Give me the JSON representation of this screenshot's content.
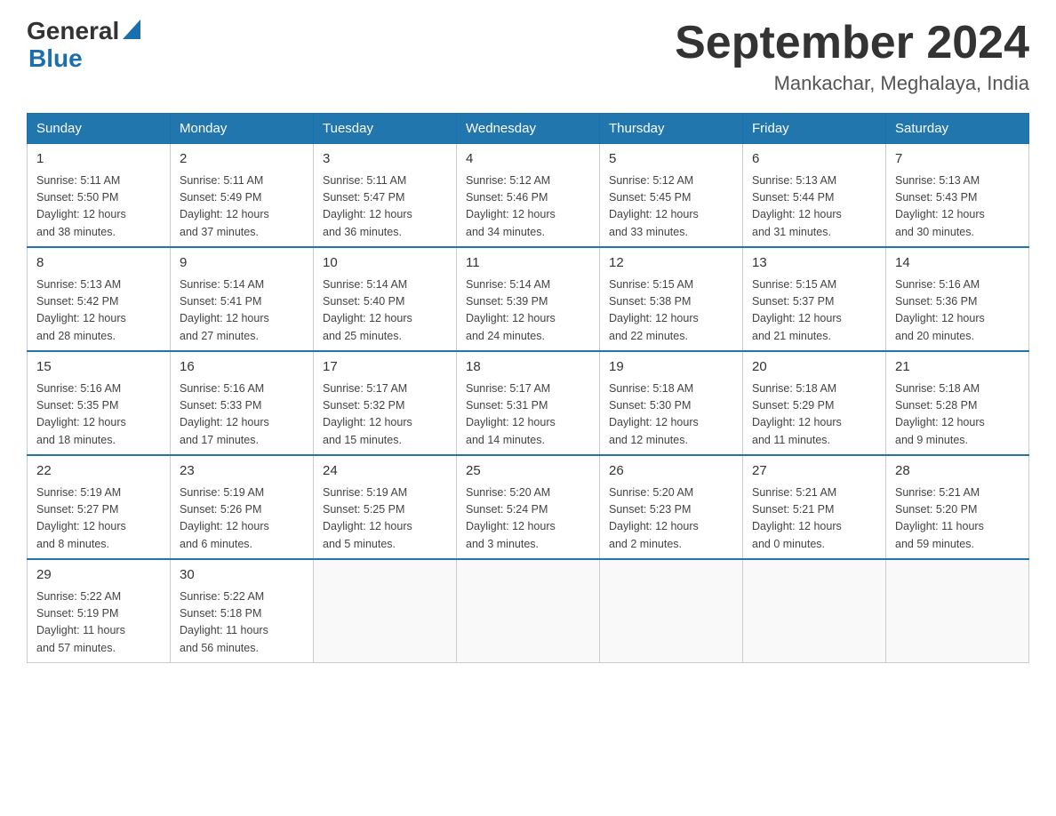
{
  "header": {
    "logo_general": "General",
    "logo_blue": "Blue",
    "month_title": "September 2024",
    "location": "Mankachar, Meghalaya, India"
  },
  "weekdays": [
    "Sunday",
    "Monday",
    "Tuesday",
    "Wednesday",
    "Thursday",
    "Friday",
    "Saturday"
  ],
  "weeks": [
    [
      {
        "day": "1",
        "sunrise": "5:11 AM",
        "sunset": "5:50 PM",
        "daylight": "12 hours and 38 minutes."
      },
      {
        "day": "2",
        "sunrise": "5:11 AM",
        "sunset": "5:49 PM",
        "daylight": "12 hours and 37 minutes."
      },
      {
        "day": "3",
        "sunrise": "5:11 AM",
        "sunset": "5:47 PM",
        "daylight": "12 hours and 36 minutes."
      },
      {
        "day": "4",
        "sunrise": "5:12 AM",
        "sunset": "5:46 PM",
        "daylight": "12 hours and 34 minutes."
      },
      {
        "day": "5",
        "sunrise": "5:12 AM",
        "sunset": "5:45 PM",
        "daylight": "12 hours and 33 minutes."
      },
      {
        "day": "6",
        "sunrise": "5:13 AM",
        "sunset": "5:44 PM",
        "daylight": "12 hours and 31 minutes."
      },
      {
        "day": "7",
        "sunrise": "5:13 AM",
        "sunset": "5:43 PM",
        "daylight": "12 hours and 30 minutes."
      }
    ],
    [
      {
        "day": "8",
        "sunrise": "5:13 AM",
        "sunset": "5:42 PM",
        "daylight": "12 hours and 28 minutes."
      },
      {
        "day": "9",
        "sunrise": "5:14 AM",
        "sunset": "5:41 PM",
        "daylight": "12 hours and 27 minutes."
      },
      {
        "day": "10",
        "sunrise": "5:14 AM",
        "sunset": "5:40 PM",
        "daylight": "12 hours and 25 minutes."
      },
      {
        "day": "11",
        "sunrise": "5:14 AM",
        "sunset": "5:39 PM",
        "daylight": "12 hours and 24 minutes."
      },
      {
        "day": "12",
        "sunrise": "5:15 AM",
        "sunset": "5:38 PM",
        "daylight": "12 hours and 22 minutes."
      },
      {
        "day": "13",
        "sunrise": "5:15 AM",
        "sunset": "5:37 PM",
        "daylight": "12 hours and 21 minutes."
      },
      {
        "day": "14",
        "sunrise": "5:16 AM",
        "sunset": "5:36 PM",
        "daylight": "12 hours and 20 minutes."
      }
    ],
    [
      {
        "day": "15",
        "sunrise": "5:16 AM",
        "sunset": "5:35 PM",
        "daylight": "12 hours and 18 minutes."
      },
      {
        "day": "16",
        "sunrise": "5:16 AM",
        "sunset": "5:33 PM",
        "daylight": "12 hours and 17 minutes."
      },
      {
        "day": "17",
        "sunrise": "5:17 AM",
        "sunset": "5:32 PM",
        "daylight": "12 hours and 15 minutes."
      },
      {
        "day": "18",
        "sunrise": "5:17 AM",
        "sunset": "5:31 PM",
        "daylight": "12 hours and 14 minutes."
      },
      {
        "day": "19",
        "sunrise": "5:18 AM",
        "sunset": "5:30 PM",
        "daylight": "12 hours and 12 minutes."
      },
      {
        "day": "20",
        "sunrise": "5:18 AM",
        "sunset": "5:29 PM",
        "daylight": "12 hours and 11 minutes."
      },
      {
        "day": "21",
        "sunrise": "5:18 AM",
        "sunset": "5:28 PM",
        "daylight": "12 hours and 9 minutes."
      }
    ],
    [
      {
        "day": "22",
        "sunrise": "5:19 AM",
        "sunset": "5:27 PM",
        "daylight": "12 hours and 8 minutes."
      },
      {
        "day": "23",
        "sunrise": "5:19 AM",
        "sunset": "5:26 PM",
        "daylight": "12 hours and 6 minutes."
      },
      {
        "day": "24",
        "sunrise": "5:19 AM",
        "sunset": "5:25 PM",
        "daylight": "12 hours and 5 minutes."
      },
      {
        "day": "25",
        "sunrise": "5:20 AM",
        "sunset": "5:24 PM",
        "daylight": "12 hours and 3 minutes."
      },
      {
        "day": "26",
        "sunrise": "5:20 AM",
        "sunset": "5:23 PM",
        "daylight": "12 hours and 2 minutes."
      },
      {
        "day": "27",
        "sunrise": "5:21 AM",
        "sunset": "5:21 PM",
        "daylight": "12 hours and 0 minutes."
      },
      {
        "day": "28",
        "sunrise": "5:21 AM",
        "sunset": "5:20 PM",
        "daylight": "11 hours and 59 minutes."
      }
    ],
    [
      {
        "day": "29",
        "sunrise": "5:22 AM",
        "sunset": "5:19 PM",
        "daylight": "11 hours and 57 minutes."
      },
      {
        "day": "30",
        "sunrise": "5:22 AM",
        "sunset": "5:18 PM",
        "daylight": "11 hours and 56 minutes."
      },
      null,
      null,
      null,
      null,
      null
    ]
  ],
  "labels": {
    "sunrise": "Sunrise:",
    "sunset": "Sunset:",
    "daylight": "Daylight:"
  }
}
